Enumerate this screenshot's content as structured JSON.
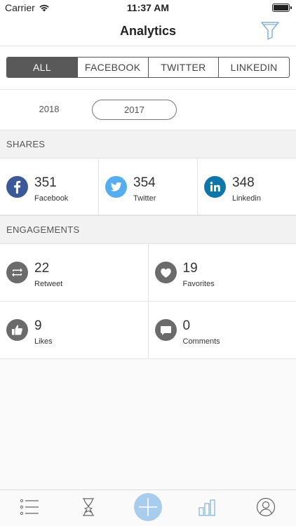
{
  "status_bar": {
    "carrier": "Carrier",
    "time": "11:37 AM"
  },
  "header": {
    "title": "Analytics"
  },
  "filter_tabs": [
    {
      "label": "ALL",
      "active": true
    },
    {
      "label": "FACEBOOK",
      "active": false
    },
    {
      "label": "TWITTER",
      "active": false
    },
    {
      "label": "LINKEDIN",
      "active": false
    }
  ],
  "years": [
    {
      "label": "2018",
      "selected": false
    },
    {
      "label": "2017",
      "selected": true
    }
  ],
  "shares": {
    "heading": "SHARES",
    "items": [
      {
        "value": "351",
        "label": "Facebook",
        "icon": "facebook-icon",
        "color": "#3b5998"
      },
      {
        "value": "354",
        "label": "Twitter",
        "icon": "twitter-icon",
        "color": "#55acee"
      },
      {
        "value": "348",
        "label": "Linkedin",
        "icon": "linkedin-icon",
        "color": "#0e76a8"
      }
    ]
  },
  "engagements": {
    "heading": "ENGAGEMENTS",
    "items": [
      {
        "value": "22",
        "label": "Retweet",
        "icon": "retweet-icon"
      },
      {
        "value": "19",
        "label": "Favorites",
        "icon": "heart-icon"
      },
      {
        "value": "9",
        "label": "Likes",
        "icon": "thumbs-up-icon"
      },
      {
        "value": "0",
        "label": "Comments",
        "icon": "comment-icon"
      }
    ],
    "icon_color": "#6b6b6b"
  },
  "tab_bar": {
    "items": [
      {
        "icon": "list-icon"
      },
      {
        "icon": "hourglass-star-icon"
      },
      {
        "icon": "add-icon"
      },
      {
        "icon": "bar-chart-icon",
        "active": true
      },
      {
        "icon": "profile-icon"
      }
    ],
    "accent": "#a8ccee"
  }
}
